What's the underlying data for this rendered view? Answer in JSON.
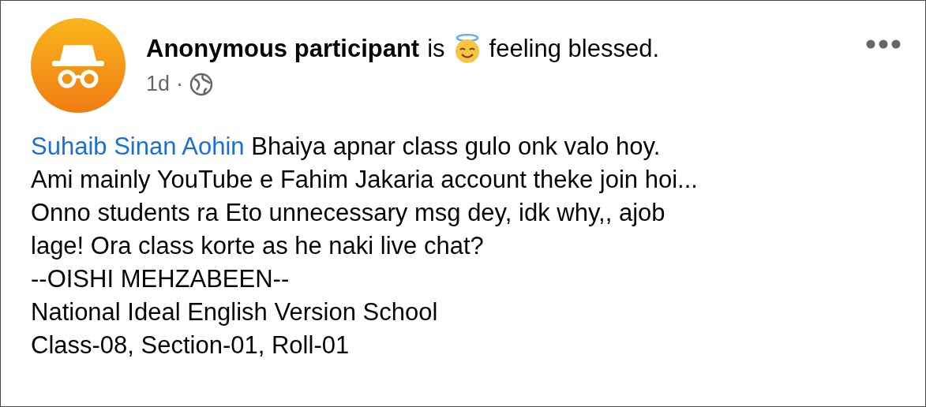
{
  "post": {
    "author": "Anonymous participant",
    "verb": "is",
    "feeling": "feeling blessed.",
    "time": "1d",
    "separator": "·",
    "mention": "Suhaib Sinan Aohin",
    "lines": [
      "Bhaiya apnar class gulo onk valo hoy.",
      "Ami mainly YouTube e Fahim Jakaria account theke join hoi...",
      "Onno students ra Eto unnecessary msg dey, idk why,, ajob",
      "lage! Ora class korte as he naki live chat?",
      "--OISHI MEHZABEEN--",
      "National Ideal English Version School",
      "Class-08, Section-01, Roll-01"
    ]
  }
}
